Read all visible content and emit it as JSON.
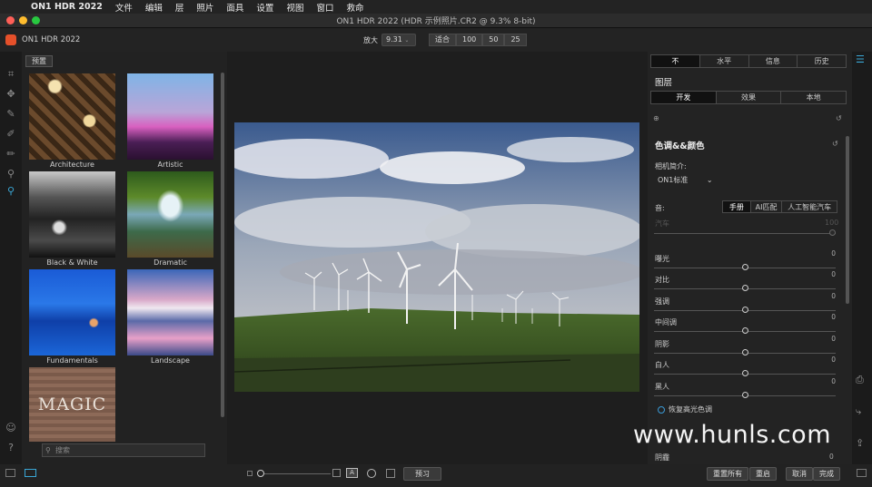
{
  "menubar": {
    "app": "ON1 HDR 2022",
    "items": [
      "文件",
      "编辑",
      "层",
      "照片",
      "面具",
      "设置",
      "视图",
      "窗口",
      "救命"
    ]
  },
  "window": {
    "title": "ON1 HDR 2022 (HDR 示例照片.CR2 @ 9.3% 8-bit)"
  },
  "toolbar": {
    "app_title": "ON1 HDR 2022",
    "zoom_label": "放大",
    "zoom_value": "9.31",
    "fit_label": "适合",
    "zoom_presets": [
      "100",
      "50",
      "25"
    ]
  },
  "presets": {
    "button": "预置",
    "items": [
      {
        "label": "Architecture"
      },
      {
        "label": "Artistic"
      },
      {
        "label": "Black & White"
      },
      {
        "label": "Dramatic"
      },
      {
        "label": "Fundamentals"
      },
      {
        "label": "Landscape"
      },
      {
        "label": "MAGIC"
      }
    ],
    "search_placeholder": "搜索"
  },
  "right": {
    "top_tabs": [
      "不",
      "水平",
      "信息",
      "历史"
    ],
    "layers_title": "图层",
    "sub_tabs": [
      "开发",
      "效果",
      "本地"
    ],
    "section_title": "色调&&颜色",
    "camera_profile_label": "相机简介:",
    "camera_profile_value": "ON1标准",
    "tone_label": "音:",
    "tone_modes": [
      "手册",
      "AI匹配",
      "人工智能汽车"
    ],
    "auto_label": "汽车",
    "auto_value": "100",
    "sliders": [
      {
        "name": "曝光",
        "value": "0"
      },
      {
        "name": "对比",
        "value": "0"
      },
      {
        "name": "强调",
        "value": "0"
      },
      {
        "name": "中间调",
        "value": "0"
      },
      {
        "name": "阴影",
        "value": "0"
      },
      {
        "name": "白人",
        "value": "0"
      },
      {
        "name": "黑人",
        "value": "0"
      }
    ],
    "restore_label": "恢复高光色调",
    "last_slider": {
      "name": "阴霾",
      "value": "0"
    }
  },
  "bottom": {
    "preview": "预习",
    "reset_all": "重置所有",
    "reset": "重启",
    "cancel": "取消",
    "done": "完成"
  },
  "watermark": "www.hunls.com"
}
